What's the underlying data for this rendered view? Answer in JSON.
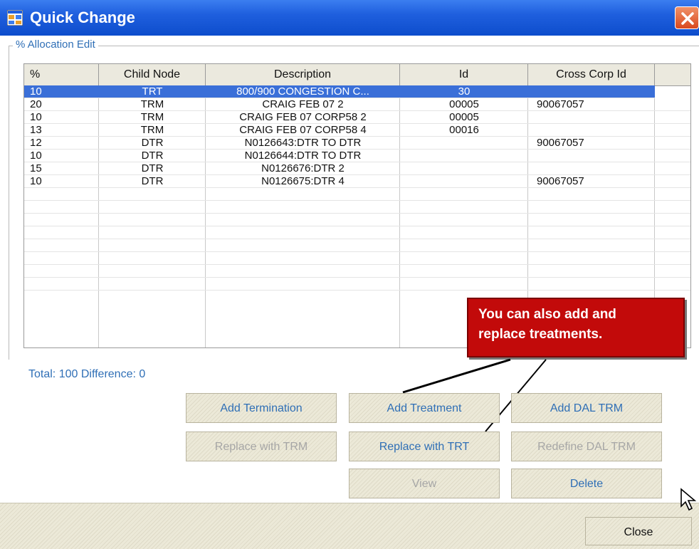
{
  "window": {
    "title": "Quick Change"
  },
  "group": {
    "label": "% Allocation Edit"
  },
  "table": {
    "columns": [
      "%",
      "Child Node",
      "Description",
      "Id",
      "Cross Corp Id"
    ],
    "rows": [
      {
        "pct": "10",
        "child_node": "TRT",
        "description": "800/900 CONGESTION C...",
        "id": "30",
        "cross_corp_id": "",
        "selected": true
      },
      {
        "pct": "20",
        "child_node": "TRM",
        "description": "CRAIG FEB 07 2",
        "id": "00005",
        "cross_corp_id": "90067057"
      },
      {
        "pct": "10",
        "child_node": "TRM",
        "description": "CRAIG FEB 07 CORP58 2",
        "id": "00005",
        "cross_corp_id": ""
      },
      {
        "pct": "13",
        "child_node": "TRM",
        "description": "CRAIG FEB 07 CORP58 4",
        "id": "00016",
        "cross_corp_id": ""
      },
      {
        "pct": "12",
        "child_node": "DTR",
        "description": "N0126643:DTR TO DTR",
        "id": "",
        "cross_corp_id": "90067057"
      },
      {
        "pct": "10",
        "child_node": "DTR",
        "description": "N0126644:DTR TO DTR",
        "id": "",
        "cross_corp_id": ""
      },
      {
        "pct": "15",
        "child_node": "DTR",
        "description": "N0126676:DTR 2",
        "id": "",
        "cross_corp_id": ""
      },
      {
        "pct": "10",
        "child_node": "DTR",
        "description": "N0126675:DTR 4",
        "id": "",
        "cross_corp_id": "90067057"
      }
    ]
  },
  "total": {
    "text": "Total: 100 Difference: 0"
  },
  "buttons": {
    "add_termination": "Add Termination",
    "add_treatment": "Add Treatment",
    "add_dal_trm": "Add DAL TRM",
    "replace_with_trm": "Replace with TRM",
    "replace_with_trt": "Replace with TRT",
    "redefine_dal_trm": "Redefine DAL TRM",
    "view": "View",
    "delete": "Delete",
    "close": "Close"
  },
  "callout": {
    "line1": "You can also add and",
    "line2": "replace treatments."
  },
  "colors": {
    "title_bar": "#1f5fde",
    "selection": "#3a6fd8",
    "label_blue": "#2f6fb6",
    "callout_red": "#c20a0a"
  }
}
